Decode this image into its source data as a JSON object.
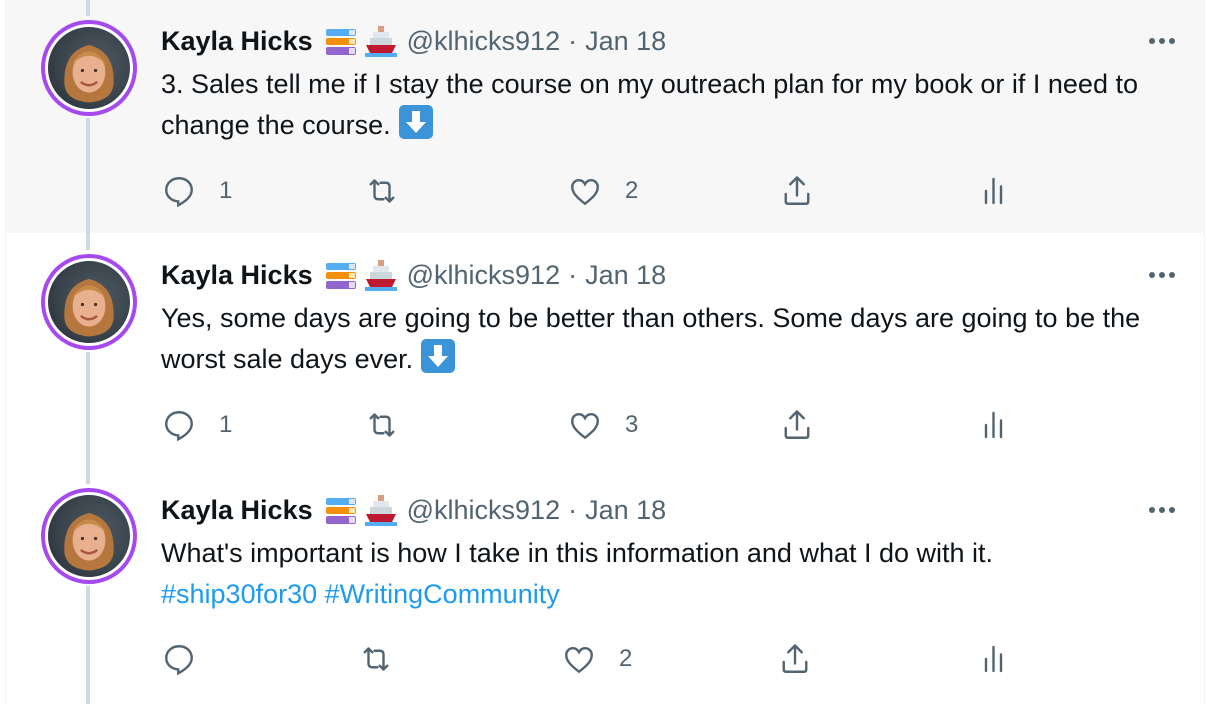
{
  "tweets": [
    {
      "name": "Kayla Hicks",
      "badges": [
        "books-emoji",
        "ship-emoji"
      ],
      "handle": "@klhicks912",
      "sep": "·",
      "date": "Jan 18",
      "text_before": "3. Sales tell me if I stay the course on my outreach plan for my book or if I need to change the course.",
      "tags": [],
      "has_arrow": true,
      "replies": "1",
      "retweets": "",
      "likes": "2"
    },
    {
      "name": "Kayla Hicks",
      "badges": [
        "books-emoji",
        "ship-emoji"
      ],
      "handle": "@klhicks912",
      "sep": "·",
      "date": "Jan 18",
      "text_before": "Yes, some days are going to be better than others. Some days are going to be the worst sale days ever.",
      "tags": [],
      "has_arrow": true,
      "replies": "1",
      "retweets": "",
      "likes": "3"
    },
    {
      "name": "Kayla Hicks",
      "badges": [
        "books-emoji",
        "ship-emoji"
      ],
      "handle": "@klhicks912",
      "sep": "·",
      "date": "Jan 18",
      "text_before": "What's important is how I take in this information and what I do with it.",
      "tags": [
        "#ship30for30",
        "#WritingCommunity"
      ],
      "has_arrow": false,
      "replies": "",
      "retweets": "",
      "likes": "2"
    }
  ],
  "icons": {
    "reply": "reply-icon",
    "retweet": "retweet-icon",
    "like": "like-icon",
    "share": "share-icon",
    "analytics": "analytics-icon",
    "more": "more-icon",
    "arrow": "down-arrow-emoji"
  },
  "colors": {
    "accent_link": "#1d9bf0",
    "avatar_ring": "#a64af0",
    "muted": "#536471",
    "highlight_bg": "#f7f7f7",
    "thread_line": "#cfd9de"
  }
}
